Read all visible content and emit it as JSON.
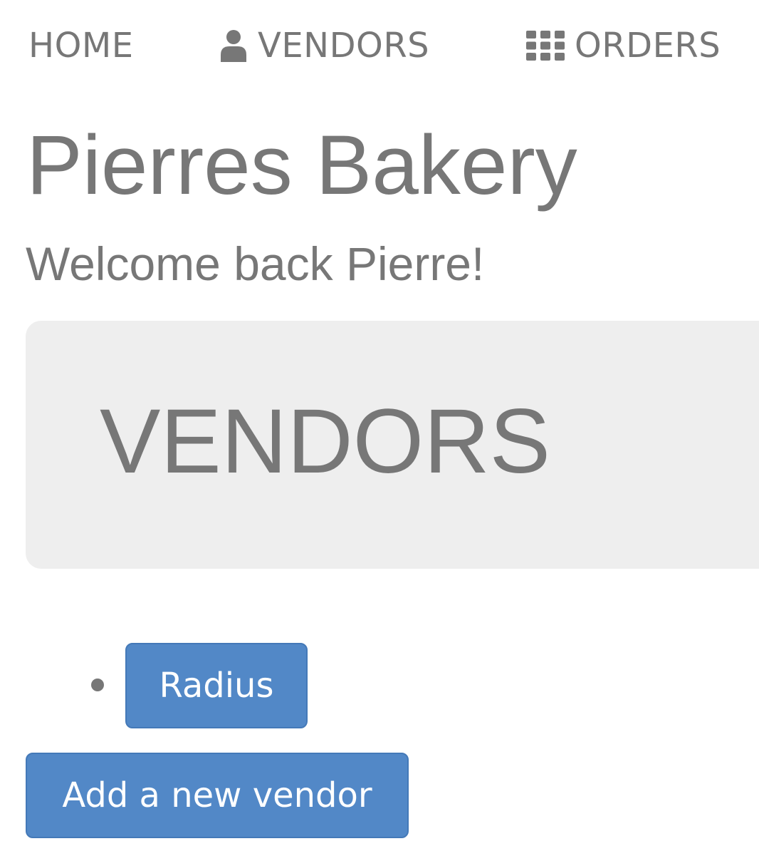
{
  "nav": {
    "home": {
      "label": "HOME"
    },
    "vendors": {
      "label": "VENDORS",
      "icon": "user-icon"
    },
    "orders": {
      "label": "ORDERS",
      "icon": "grid-icon"
    }
  },
  "page": {
    "title": "Pierres Bakery",
    "welcome": "Welcome back Pierre!"
  },
  "jumbotron": {
    "heading": "VENDORS"
  },
  "vendors": [
    {
      "name": "Radius"
    }
  ],
  "actions": {
    "add_vendor": "Add a new vendor"
  },
  "colors": {
    "text": "#777777",
    "jumbotron_bg": "#eeeeee",
    "button_bg": "#5288c7",
    "button_border": "#4479b8",
    "button_text": "#ffffff"
  }
}
